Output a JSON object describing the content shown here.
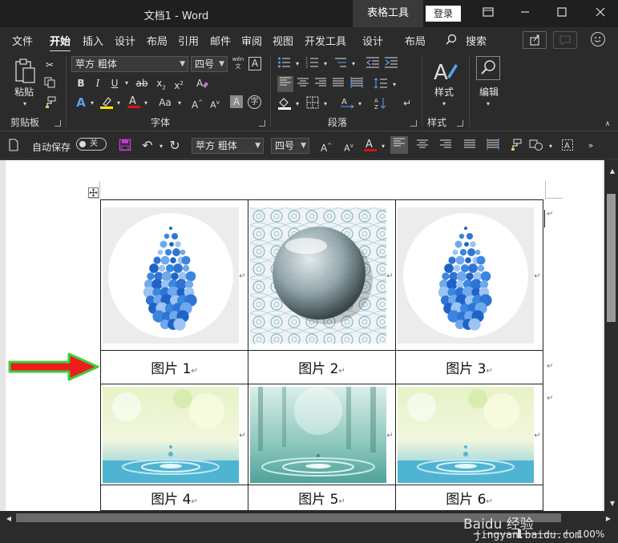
{
  "window": {
    "title": "文档1  -  Word",
    "context_tab": "表格工具",
    "login_label": "登录",
    "controls": [
      "restore-icon",
      "minimize-icon",
      "maximize-icon",
      "close-icon"
    ]
  },
  "menu": {
    "tabs": [
      "文件",
      "开始",
      "插入",
      "设计",
      "布局",
      "引用",
      "邮件",
      "审阅",
      "视图",
      "开发工具",
      "设计",
      "布局"
    ],
    "active_tab": "开始",
    "search_label": "搜索"
  },
  "ribbon": {
    "paste_label": "粘贴",
    "clipboard_label": "剪贴板",
    "font_label": "字体",
    "paragraph_label": "段落",
    "styles_group_label": "样式",
    "styles_btn_label": "样式",
    "editing_btn_label": "编辑",
    "font_name": "苹方 粗体",
    "font_size": "四号",
    "wen_glyph": "wén\n文",
    "a_box": "A"
  },
  "qat": {
    "autosave_label": "自动保存",
    "toggle_label": "关",
    "font_name": "苹方 粗体",
    "font_size": "四号"
  },
  "document": {
    "captions": [
      "图片 1",
      "图片 2",
      "图片 3",
      "图片 4",
      "图片 5",
      "图片 6"
    ],
    "para_mark": "↵"
  },
  "status": {
    "zoom": "100%",
    "watermark_brand": "Baidu 经验",
    "watermark_url": "jingyan.baidu.com"
  },
  "colors": {
    "highlight_yellow": "#ffe600",
    "font_red": "#e01010",
    "arrow_red": "#ee1c1c",
    "arrow_green": "#3ccf3c",
    "save_purple": "#c23ecf"
  }
}
